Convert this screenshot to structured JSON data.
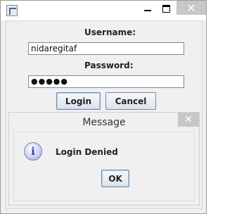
{
  "window": {
    "minimize_icon": "minimize-icon",
    "maximize_icon": "maximize-icon",
    "close_glyph": "✕"
  },
  "form": {
    "username_label": "Username:",
    "username_value": "nidaregitaf",
    "password_label": "Password:",
    "password_value": "●●●●●",
    "login_label": "Login",
    "cancel_label": "Cancel"
  },
  "dialog": {
    "title": "Message",
    "close_glyph": "✕",
    "icon_glyph": "i",
    "message": "Login Denied",
    "ok_label": "OK"
  }
}
